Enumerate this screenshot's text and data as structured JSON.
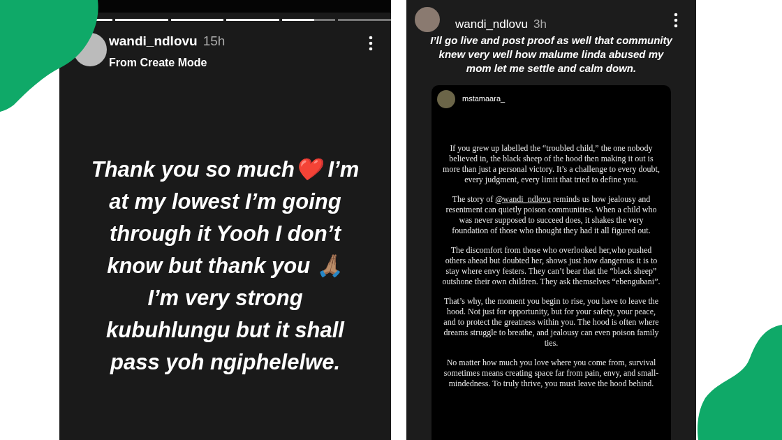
{
  "left_story": {
    "progress": [
      {
        "level": 1
      },
      {
        "level": 1
      },
      {
        "level": 1
      },
      {
        "level": 1
      },
      {
        "level": 0.6
      },
      {
        "level": 0
      }
    ],
    "username": "wandi_ndlovu",
    "time": "15h",
    "subtitle": "From Create Mode",
    "caption": "Thank you so much❤️ I’m at my lowest I’m going through it Yooh I don’t know but thank you 🙏🏽 I’m very strong kubuhlungu but it shall pass yoh ngiphelelwe."
  },
  "right_story": {
    "username": "wandi_ndlovu",
    "time": "3h",
    "caption": "I’ll go live and post proof as well that community knew very well how malume linda abused my mom let me settle and calm down.",
    "shared_post": {
      "username": "mstamaara_",
      "paragraphs": [
        {
          "text": "If you grew up labelled the “troubled child,” the one nobody believed in, the black sheep of the hood then making it out is more than just a personal victory. It’s a challenge to every doubt, every judgment, every limit that tried to define you."
        },
        {
          "before": "The story of",
          "mention": "@wandi_ndlovu",
          "text": "reminds us how jealousy and resentment can quietly poison communities. When a child who was never supposed to succeed does, it shakes the very foundation of those who thought they had it all figured out."
        },
        {
          "text": "The discomfort from those who overlooked her,who pushed others ahead but doubted her, shows just how dangerous it is to stay where envy festers. They can’t bear that the “black sheep” outshone their own children. They ask themselves “ebengubani”."
        },
        {
          "text": "That’s why, the moment you begin to rise, you have to leave the hood. Not just for opportunity, but for your safety, your peace, and to protect the greatness within you. The hood is often where dreams struggle to breathe, and jealousy can even poison family ties."
        },
        {
          "text": "No matter how much you love where you come from, survival sometimes means creating space far from pain, envy, and small-mindedness. To truly thrive, you must leave the hood behind."
        }
      ]
    }
  }
}
